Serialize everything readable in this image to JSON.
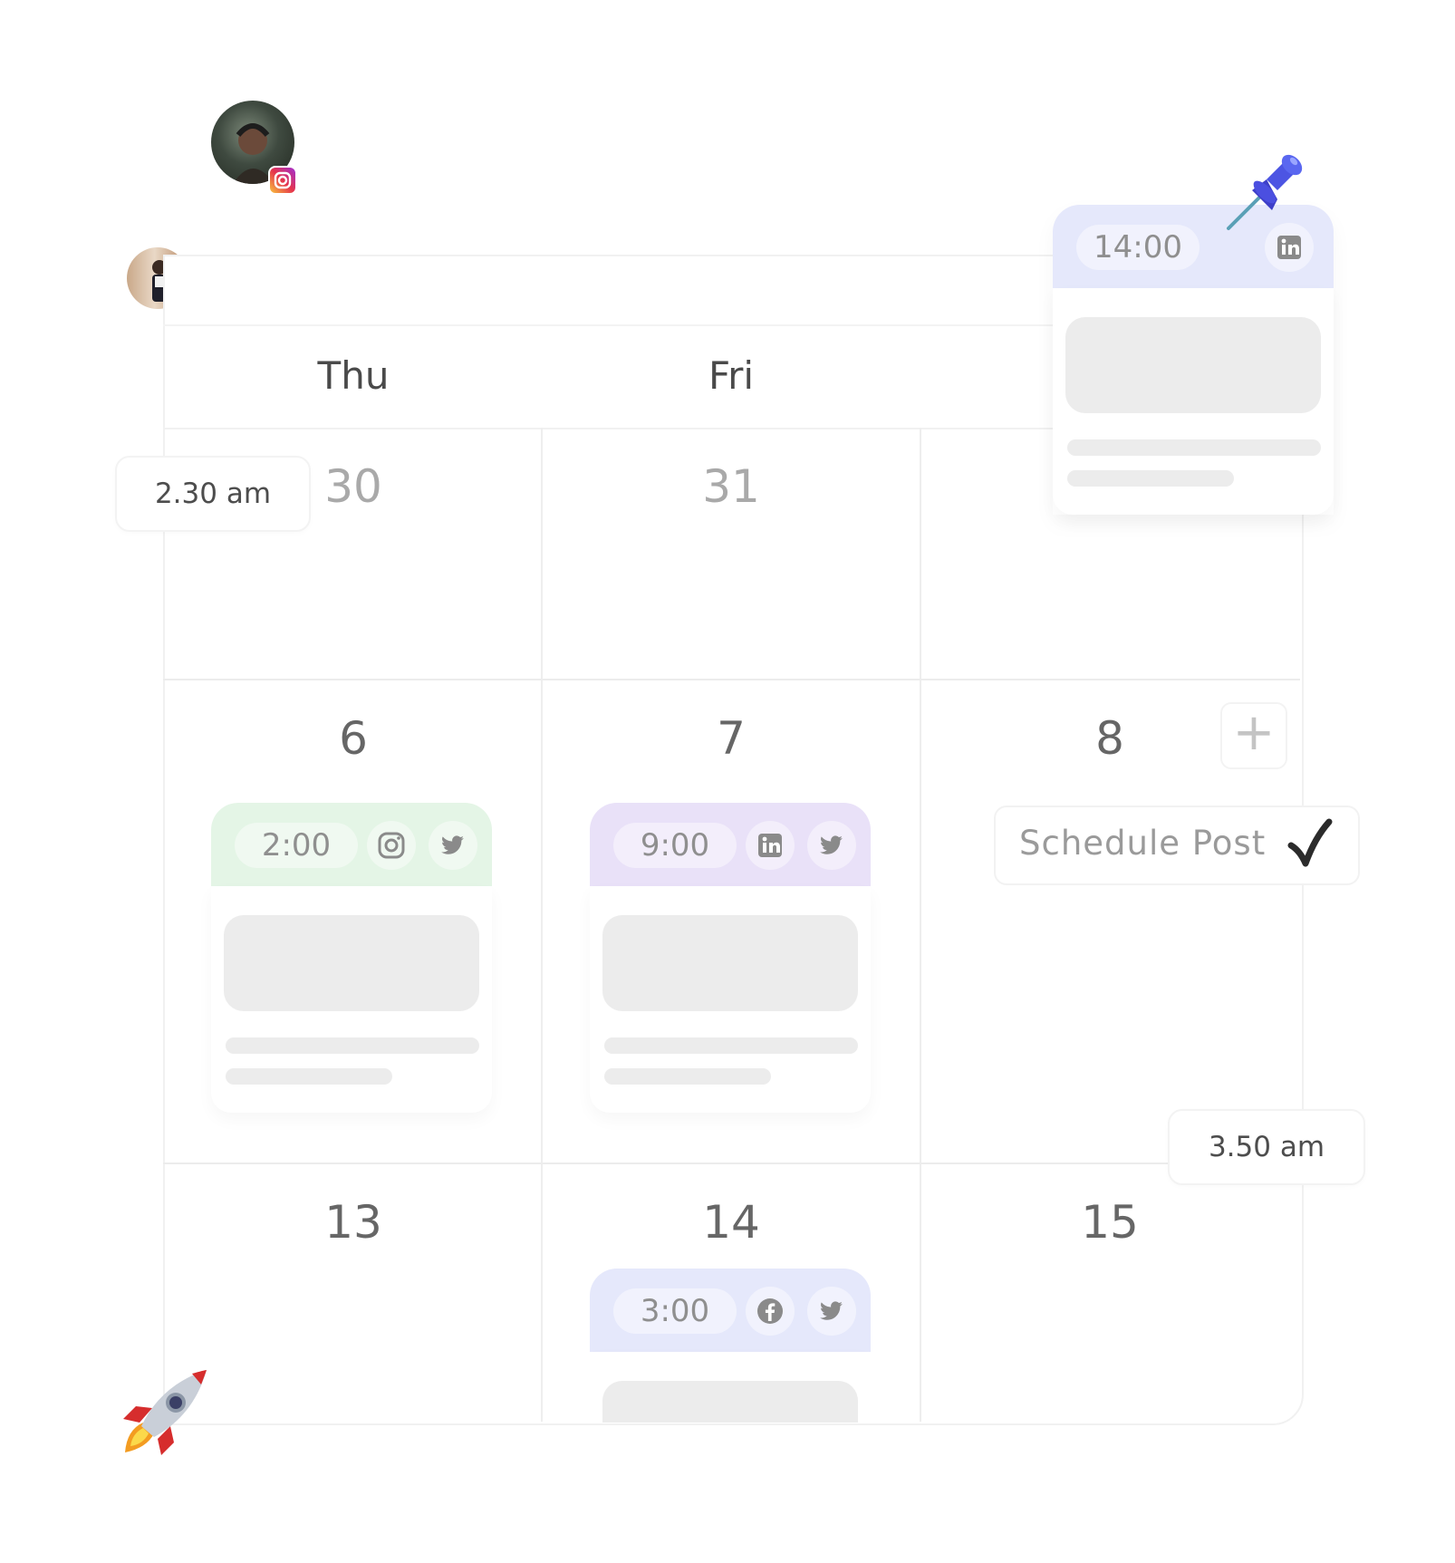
{
  "calendar": {
    "day_names": [
      "Thu",
      "Fri"
    ],
    "weeks": [
      [
        "30",
        "31"
      ],
      [
        "6",
        "7",
        "8"
      ],
      [
        "13",
        "14",
        "15"
      ]
    ]
  },
  "time_chips": {
    "first": "2.30 am",
    "second": "3.50 am"
  },
  "posts": [
    {
      "time": "14:00",
      "platforms": [
        "linkedin"
      ],
      "color": "#e5e8fb"
    },
    {
      "time": "2:00",
      "platforms": [
        "instagram",
        "twitter"
      ],
      "color": "#e4f5e6"
    },
    {
      "time": "9:00",
      "platforms": [
        "linkedin",
        "twitter"
      ],
      "color": "#e9e1f8"
    },
    {
      "time": "3:00",
      "platforms": [
        "facebook",
        "twitter"
      ],
      "color": "#e5e8fb"
    }
  ],
  "schedule": {
    "label": "Schedule Post",
    "check_icon": "check-icon"
  },
  "add_icon": "plus-icon",
  "decorations": [
    "pushpin-icon",
    "rocket-icon",
    "instagram-badge-icon",
    "twitter-badge-icon"
  ]
}
